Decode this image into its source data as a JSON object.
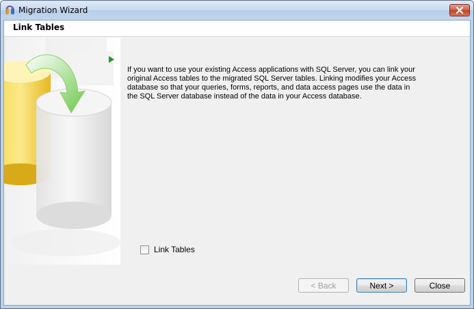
{
  "window": {
    "title": "Migration Wizard",
    "icons": {
      "app": "migration-wizard-icon",
      "close": "close-icon"
    }
  },
  "page": {
    "title": "Link Tables",
    "description": "If you want to use your existing Access applications with SQL Server, you can link your original Access tables to the migrated SQL Server tables. Linking modifies your Access database so that your queries, forms, reports, and data access pages use the data in the SQL Server database instead of the data in your Access database."
  },
  "options": {
    "link_tables": {
      "label": "Link Tables",
      "checked": false
    }
  },
  "buttons": {
    "back": "< Back",
    "next": "Next >",
    "close": "Close"
  },
  "colors": {
    "titlebar": "#c3d6ee",
    "close_button": "#c4432b",
    "dialog_background": "#f0f0f0",
    "default_button_border": "#3c7fb1"
  }
}
